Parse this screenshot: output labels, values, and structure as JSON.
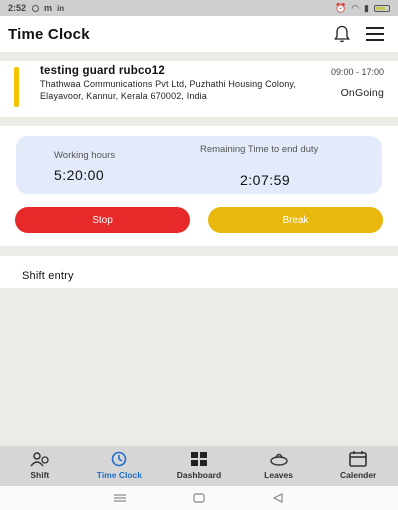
{
  "status_bar": {
    "time": "2:52"
  },
  "app_bar": {
    "title": "Time Clock"
  },
  "shift_card": {
    "guard_name": "testing guard rubco12",
    "shift_time": "09:00 - 17:00",
    "address": "Thathwaa Communications Pvt Ltd, Puzhathi Housing Colony, Elayavoor, Kannur, Kerala 670002, India",
    "status": "OnGoing"
  },
  "timer": {
    "working_hours_label": "Working hours",
    "working_hours_value": "5:20:00",
    "remaining_label": "Remaining Time to end duty",
    "remaining_value": "2:07:59"
  },
  "buttons": {
    "stop": "Stop",
    "break": "Break"
  },
  "shift_entry": {
    "label": "Shift entry"
  },
  "bottom_nav": {
    "items": [
      {
        "label": "Shift",
        "icon": "shift-icon"
      },
      {
        "label": "Time Clock",
        "icon": "clock-icon",
        "active": true
      },
      {
        "label": "Dashboard",
        "icon": "dashboard-icon"
      },
      {
        "label": "Leaves",
        "icon": "leaves-icon"
      },
      {
        "label": "Calender",
        "icon": "calendar-icon"
      }
    ]
  },
  "colors": {
    "stop": "#e8292a",
    "break": "#e8b80e",
    "accent": "#1f6fcf",
    "indicator": "#f2c300"
  }
}
